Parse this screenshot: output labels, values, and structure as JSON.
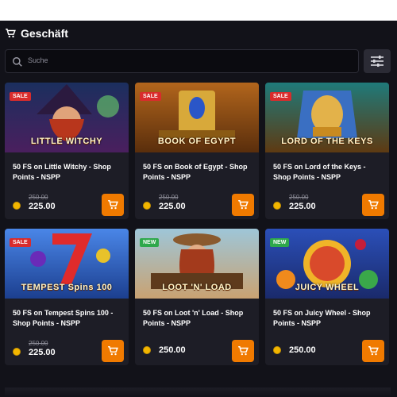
{
  "header": {
    "title": "Geschäft",
    "icon": "cart-icon"
  },
  "search": {
    "placeholder": "Suche",
    "icon": "search-icon"
  },
  "filter": {
    "icon": "filter-sliders-icon"
  },
  "colors": {
    "accent": "#f07a00",
    "sale": "#d92c2c",
    "new": "#2ea84b",
    "coin": "#f2b600"
  },
  "cards": [
    {
      "title": "50 FS on Little Witchy - Shop Points - NSPP",
      "tag": "SALE",
      "old_price": "250.00",
      "price": "225.00",
      "art_text": "LITTLE WITCHY"
    },
    {
      "title": "50 FS on Book of Egypt - Shop Points - NSPP",
      "tag": "SALE",
      "old_price": "250.00",
      "price": "225.00",
      "art_text": "BOOK OF EGYPT"
    },
    {
      "title": "50 FS on Lord of the Keys - Shop Points - NSPP",
      "tag": "SALE",
      "old_price": "250.00",
      "price": "225.00",
      "art_text": "LORD OF THE KEYS"
    },
    {
      "title": "50 FS on Tempest Spins 100 - Shop Points - NSPP",
      "tag": "SALE",
      "old_price": "250.00",
      "price": "225.00",
      "art_text": "TEMPEST Spins 100"
    },
    {
      "title": "50 FS on Loot 'n' Load - Shop Points - NSPP",
      "tag": "NEW",
      "price": "250.00",
      "art_text": "LOOT 'N' LOAD"
    },
    {
      "title": "50 FS on Juicy Wheel - Shop Points - NSPP",
      "tag": "NEW",
      "price": "250.00",
      "art_text": "JUICY WHEEL"
    }
  ]
}
